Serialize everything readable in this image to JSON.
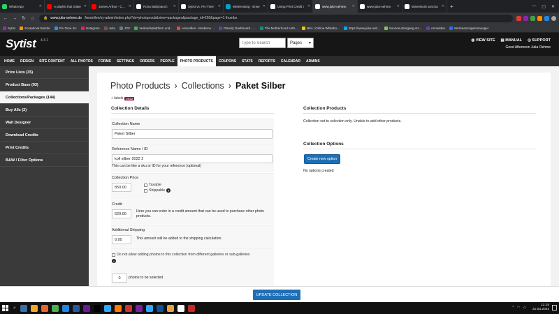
{
  "browser": {
    "tabs": [
      {
        "title": "WhatsApp",
        "color": "#25d366",
        "active": false
      },
      {
        "title": "A playlist that make",
        "color": "#ff0000",
        "active": false
      },
      {
        "title": "James Arthur - Cars",
        "color": "#ff0000",
        "active": false
      },
      {
        "title": "Rona Babybauch",
        "color": "#ffffff",
        "active": false
      },
      {
        "title": "Sytist vs. Pic-Time",
        "color": "#ffffff",
        "active": false
      },
      {
        "title": "WebHosting - Erwe",
        "color": "#00a2c7",
        "active": false
      },
      {
        "title": "Using Print Credit \\",
        "color": "#ffffff",
        "active": false
      },
      {
        "title": "www.julia-oehme.",
        "color": "#ffffff",
        "active": true
      },
      {
        "title": "www.julia-oehme.",
        "color": "#ffffff",
        "active": false
      },
      {
        "title": "Warenkorb anscha",
        "color": "#ffffff",
        "active": false
      }
    ],
    "url_host": "www.julia-oehme.de",
    "url_path": "/bestellen/sy-admin/index.php?do=photoprods&view=packages&package_id=260&page=1 thumbs",
    "bookmarks": [
      "Sytist",
      "Scrapbook Builder",
      "Pic-Time Inc",
      "Instagram",
      "Julia",
      "JOF",
      "Verkaufsplattform und...",
      "Anmelden - Moderne ...",
      "Planoly Dashboard - ...",
      "The Motherhood Anth...",
      "Miro | Online Whitebo...",
      "https://www.julia-oeh...",
      "Sonnenuntergang-sm...",
      "Anmelden",
      "Werbeanzeigenmanager"
    ]
  },
  "app": {
    "logo": "Sytist",
    "version": "4.4.1",
    "search_placeholder": "Type to Search",
    "page_select": "Pages",
    "view_site": "VIEW SITE",
    "manual": "MANUAL",
    "support": "SUPPORT",
    "greeting": "Good Afternoon Julia Oehme"
  },
  "mainnav": [
    "HOME",
    "DESIGN",
    "SITE CONTENT",
    "ALL PHOTOS",
    "FORMS",
    "SETTINGS",
    "ORDERS",
    "PEOPLE",
    "PHOTO PRODUCTS",
    "COUPONS",
    "STATS",
    "REPORTS",
    "CALENDAR",
    "ADMINS"
  ],
  "mainnav_active": "PHOTO PRODUCTS",
  "sidebar": [
    {
      "label": "Price Lists (35)",
      "active": false
    },
    {
      "label": "Product Base (93)",
      "active": false
    },
    {
      "label": "Collections/Packages (144)",
      "active": true
    },
    {
      "label": "Buy Alls (2)",
      "active": false
    },
    {
      "label": "Wall Designer",
      "active": false
    },
    {
      "label": "Download Credits",
      "active": false
    },
    {
      "label": "Print Credits",
      "active": false
    },
    {
      "label": "B&W / Filter Options",
      "active": false
    }
  ],
  "breadcrumb": {
    "part1": "Photo Products",
    "part2": "Collections",
    "current": "Paket Silber",
    "sep": "›"
  },
  "labels": {
    "text": "+ labels",
    "badge": "2022"
  },
  "details": {
    "heading": "Collection Details",
    "name_label": "Collection Name",
    "name_value": "Paket Silber",
    "ref_label": "Reference Name / ID",
    "ref_value": "koll silber 2022 2",
    "ref_hint": "This can be like a sku or ID for your reference (optional)",
    "price_label": "Collection Price",
    "price_value": "850.00",
    "taxable": "Taxable",
    "shippable": "Shippable",
    "credit_label": "Credit",
    "credit_value": "620.00",
    "credit_hint": "Here you can enter in a credit amount that can be used to purchase other photo products.",
    "ship_label": "Additional Shipping",
    "ship_value": "0.00",
    "ship_hint": "This amount will be added to the shipping calculation.",
    "galleries_text": "Do not allow adding photos to this collection from different galleries or sub-galleries",
    "photos_value": "0",
    "photos_text": "photos to be selected"
  },
  "products": {
    "heading": "Collection Products",
    "text": "Collection set to selection only. Unable to add other products."
  },
  "options": {
    "heading": "Collection Options",
    "button": "Create new option",
    "empty": "No options created"
  },
  "update_button": "UPDATE COLLECTION",
  "taskbar": {
    "time": "12:15",
    "date": "31.03.2022",
    "icons": [
      "#3a6ea5",
      "#f5a623",
      "#e8642c",
      "#4caf50",
      "#1e88e5",
      "#2b579a",
      "#6a1b9a",
      "#000000",
      "#31a8ff",
      "#ff7c00",
      "#d32f2f",
      "#7b1fa2",
      "#31a8ff",
      "#0b5394",
      "#e8a33d",
      "#ffffff",
      "#c62828"
    ]
  }
}
